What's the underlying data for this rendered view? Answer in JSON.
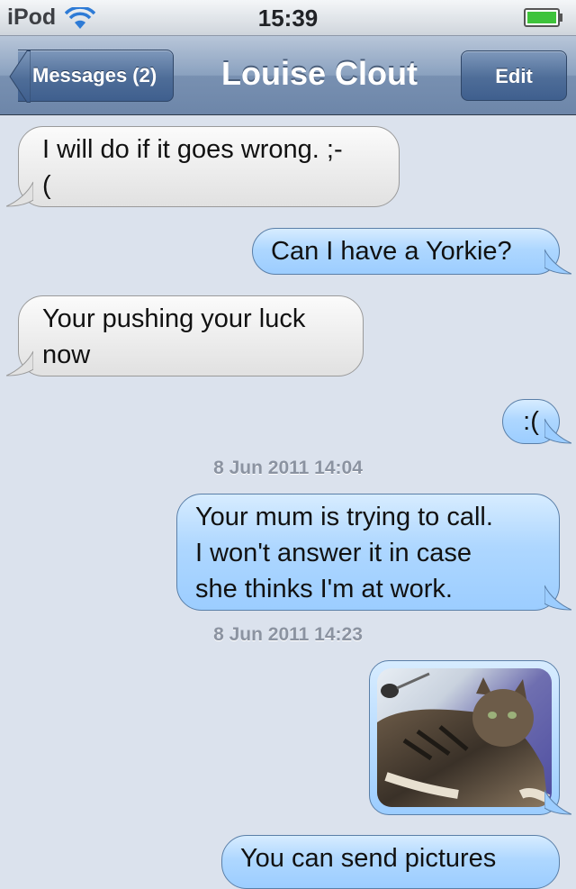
{
  "status_bar": {
    "carrier": "iPod",
    "time": "15:39"
  },
  "nav": {
    "back_label": "Messages (2)",
    "title": "Louise Clout",
    "edit_label": "Edit"
  },
  "messages": [
    {
      "direction": "incoming",
      "text": "I will do if it goes wrong. ;-\n("
    },
    {
      "direction": "outgoing",
      "text": "Can I have a Yorkie?"
    },
    {
      "direction": "incoming",
      "text": "Your pushing your luck\nnow"
    },
    {
      "direction": "outgoing",
      "text": ":("
    },
    {
      "direction": "timestamp",
      "text": "8 Jun 2011 14:04"
    },
    {
      "direction": "outgoing",
      "text": "Your mum is trying to call.\nI won't answer it in case\nshe thinks I'm at work."
    },
    {
      "direction": "timestamp",
      "text": "8 Jun 2011 14:23"
    },
    {
      "direction": "outgoing",
      "type": "photo",
      "text": ""
    },
    {
      "direction": "outgoing",
      "text": "You can send pictures"
    }
  ],
  "colors": {
    "incoming_bubble": "#e9e9e9",
    "outgoing_bubble": "#aed7ff",
    "background": "#dbe2ed",
    "navbar": "#7890b1"
  },
  "icons": [
    "wifi-icon",
    "battery-icon",
    "back-arrow-icon"
  ]
}
